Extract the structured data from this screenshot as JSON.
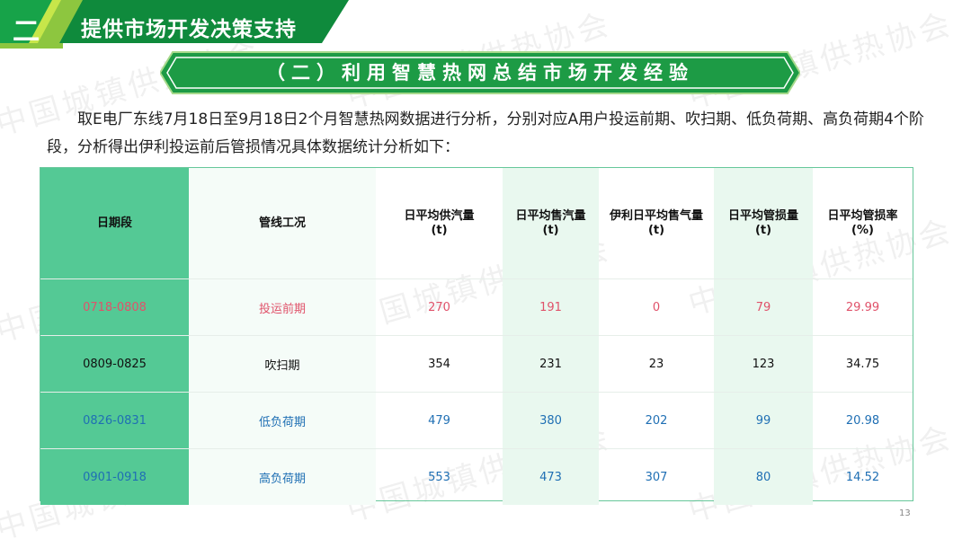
{
  "header": {
    "section_number": "二",
    "section_title": "提供市场开发决策支持",
    "banner_title": "（二）利用智慧热网总结市场开发经验"
  },
  "intro": "取E电厂东线7月18日至9月18日2个月智慧热网数据进行分析，分别对应A用户投运前期、吹扫期、低负荷期、高负荷期4个阶段，分析得出伊利投运前后管损情况具体数据统计分析如下：",
  "table": {
    "headers": [
      "日期段",
      "管线工况",
      "日平均供汽量\n(t)",
      "日平均售汽量\n(t)",
      "伊利日平均售气量\n(t)",
      "日平均管损量\n(t)",
      "日平均管损率\n(%)"
    ],
    "rows": [
      [
        "0718-0808",
        "投运前期",
        "270",
        "191",
        "0",
        "79",
        "29.99"
      ],
      [
        "0809-0825",
        "吹扫期",
        "354",
        "231",
        "23",
        "123",
        "34.75"
      ],
      [
        "0826-0831",
        "低负荷期",
        "479",
        "380",
        "202",
        "99",
        "20.98"
      ],
      [
        "0901-0918",
        "高负荷期",
        "553",
        "473",
        "307",
        "80",
        "14.52"
      ]
    ]
  },
  "watermark": "中国城镇供热协会",
  "page_number": "13",
  "colors": {
    "brand_green": "#1d9b45",
    "lime": "#8dc63f",
    "header_cell_green": "#54c995",
    "red_text": "#e0526a",
    "blue_text": "#1f6fb4"
  }
}
